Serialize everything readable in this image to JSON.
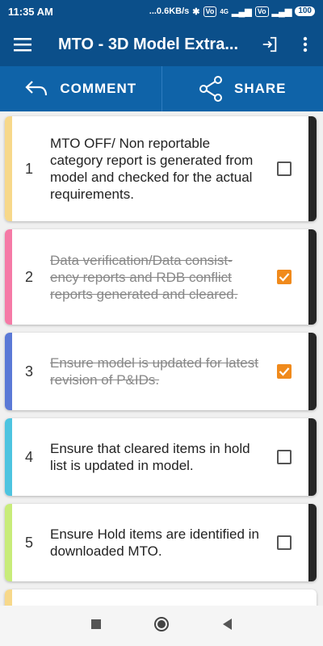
{
  "status_bar": {
    "time": "11:35 AM",
    "speed": "...0.6KB/s",
    "vo1": "Vo",
    "lte": "4G",
    "vo2": "Vo",
    "battery": "100"
  },
  "app_bar": {
    "title": "MTO - 3D Model Extra...",
    "color": "#0b4f8a"
  },
  "actions": {
    "comment_label": "COMMENT",
    "share_label": "SHARE"
  },
  "checklist": [
    {
      "number": "1",
      "text": "MTO OFF/ Non reportable category report is generated from model and checked for the actual requirements.",
      "checked": false,
      "stripe_color": "#f7d88a"
    },
    {
      "number": "2",
      "text": "Data verification/Data consist-ency reports and RDB conflict reports generated and cleared.",
      "checked": true,
      "stripe_color": "#f57aa6"
    },
    {
      "number": "3",
      "text": "Ensure model is updated for latest revision of P&IDs.",
      "checked": true,
      "stripe_color": "#5b79d6"
    },
    {
      "number": "4",
      "text": "Ensure that cleared items in hold list is updated in model.",
      "checked": false,
      "stripe_color": "#4dc4e0"
    },
    {
      "number": "5",
      "text": "Ensure Hold items are identified in downloaded MTO.",
      "checked": false,
      "stripe_color": "#c8ec7a"
    }
  ],
  "partial_next_stripe": "#f7d88a",
  "accent_check_color": "#f08a1c"
}
